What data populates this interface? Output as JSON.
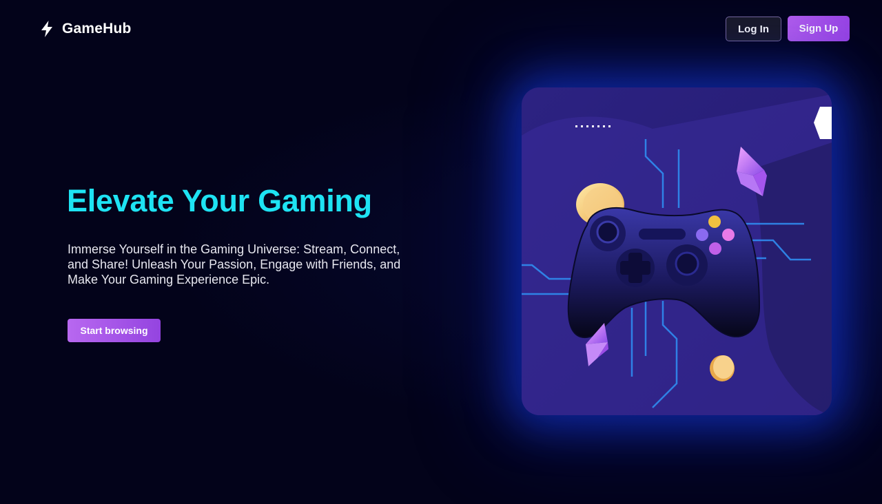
{
  "header": {
    "brand": "GameHub",
    "login_label": "Log In",
    "signup_label": "Sign Up"
  },
  "hero": {
    "title": "Elevate Your Gaming",
    "description": "Immerse Yourself in the Gaming Universe: Stream, Connect, and Share! Unleash Your Passion, Engage with Friends, and Make Your Gaming Experience Epic.",
    "cta_label": "Start browsing"
  },
  "icons": {
    "logo": "lightning-bolt-icon",
    "illustration": "game-controller-icon"
  },
  "colors": {
    "background": "#03031a",
    "accent_cyan": "#1ee3f3",
    "accent_purple": "#b65ef0",
    "card_bg": "#2a2080"
  }
}
